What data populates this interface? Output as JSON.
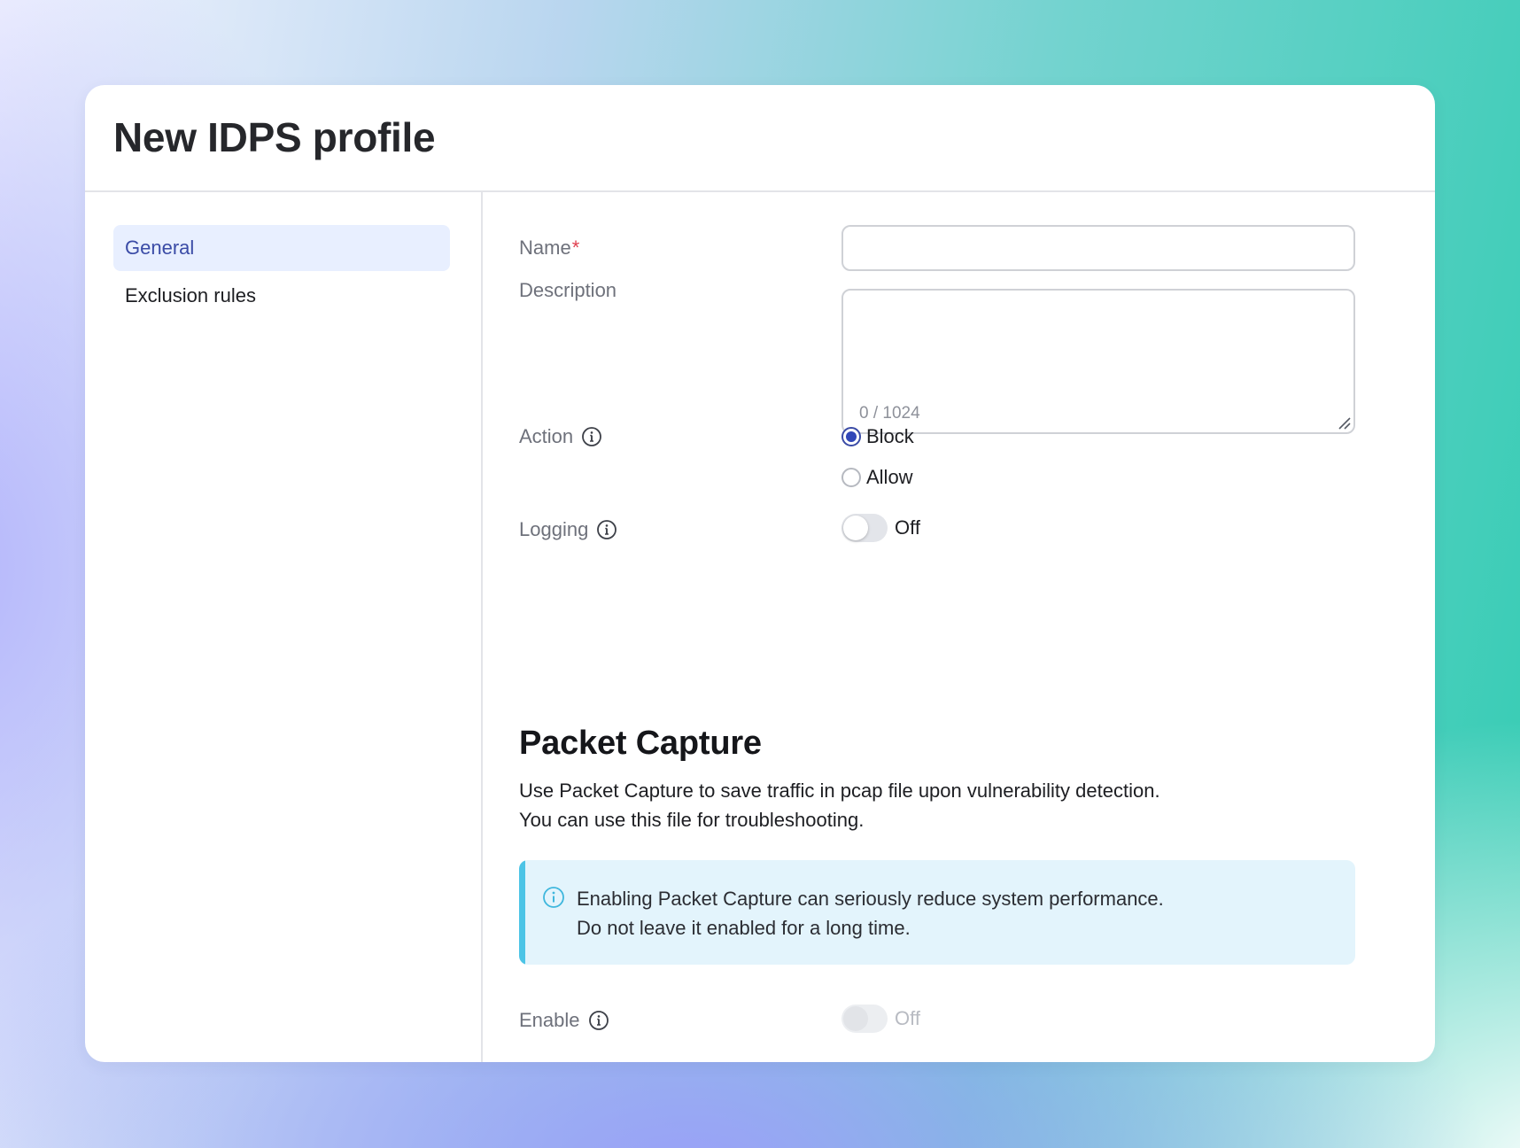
{
  "page_title": "New IDPS profile",
  "sidebar": {
    "items": [
      {
        "label": "General",
        "active": true
      },
      {
        "label": "Exclusion rules",
        "active": false
      }
    ]
  },
  "form": {
    "name": {
      "label": "Name",
      "required_mark": "*",
      "value": ""
    },
    "description": {
      "label": "Description",
      "value": "",
      "char_count": "0 / 1024"
    },
    "action": {
      "label": "Action",
      "icon": "info-icon",
      "options": [
        {
          "label": "Block",
          "selected": true
        },
        {
          "label": "Allow",
          "selected": false
        }
      ]
    },
    "logging": {
      "label": "Logging",
      "icon": "info-icon",
      "state": "Off",
      "on": false
    }
  },
  "packet_capture": {
    "title": "Packet Capture",
    "description_lines": [
      "Use Packet Capture to save traffic in pcap file upon vulnerability detection.",
      "You can use this file for troubleshooting."
    ],
    "alert": {
      "icon": "info-icon",
      "lines": [
        "Enabling Packet Capture can seriously reduce system performance.",
        "Do not leave it enabled for a long time."
      ]
    },
    "enable": {
      "label": "Enable",
      "icon": "info-icon",
      "state": "Off",
      "on": false,
      "disabled": true
    }
  },
  "colors": {
    "accent": "#3147b8",
    "nav_active_bg": "#e8efff",
    "alert_bg": "#e3f4fc",
    "alert_accent": "#4cc4e6",
    "required": "#e0404f"
  }
}
